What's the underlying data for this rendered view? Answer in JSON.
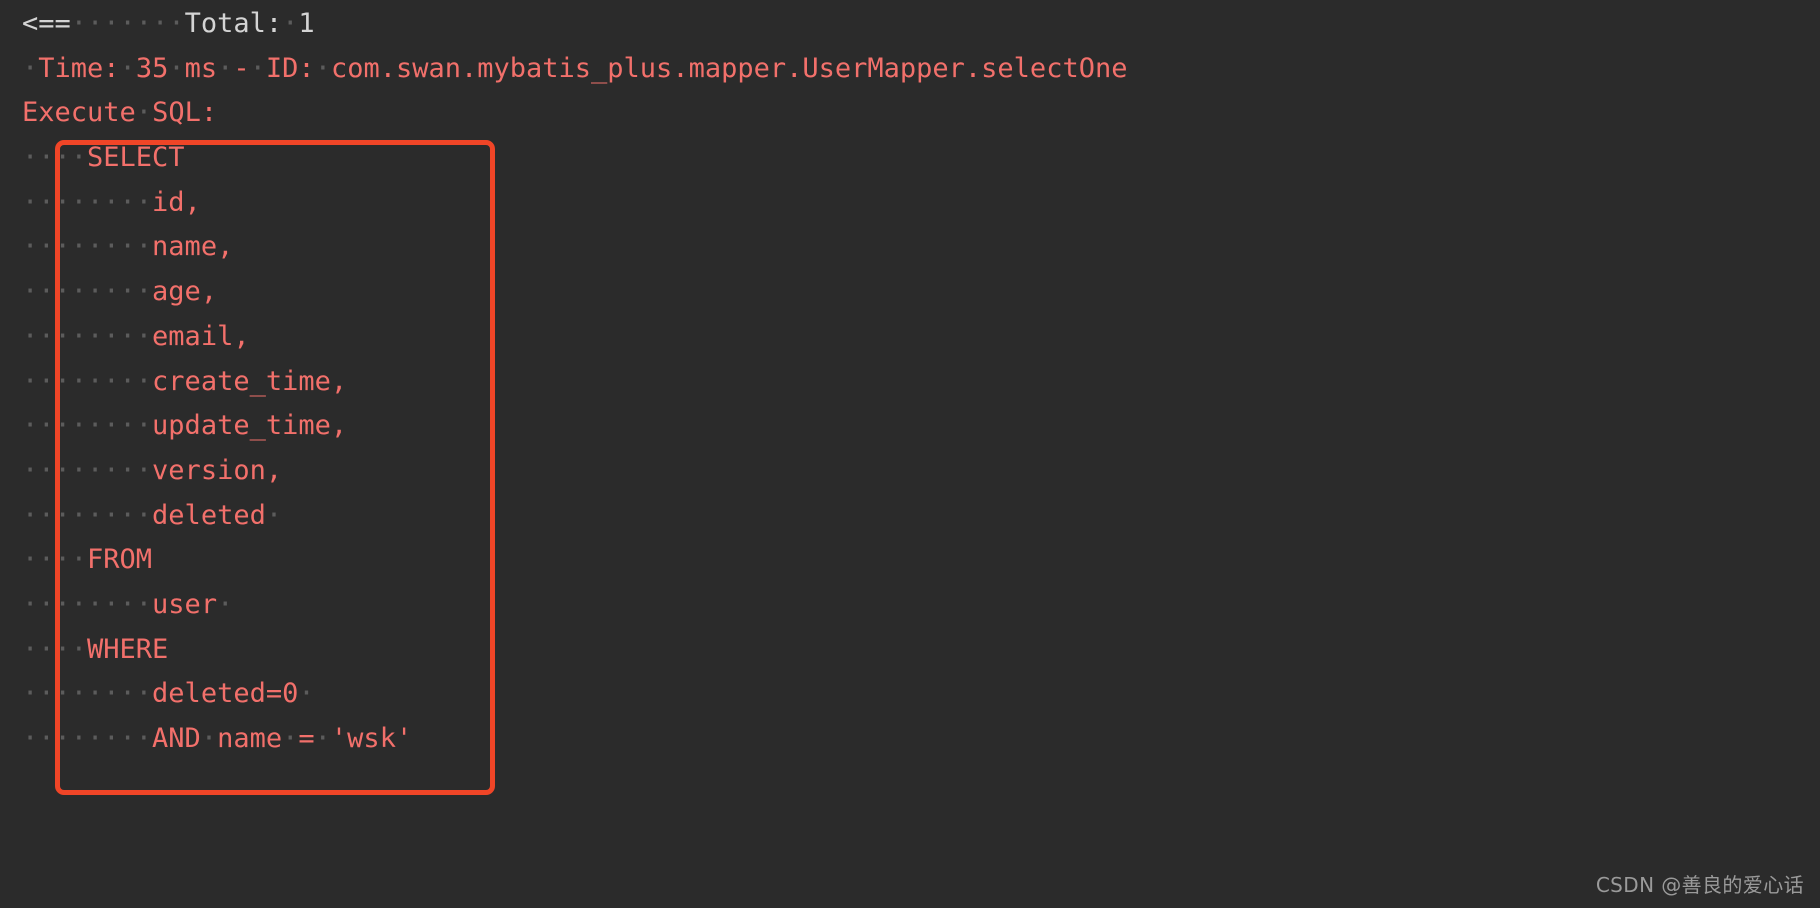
{
  "console": {
    "background_color": "#2b2b2b",
    "text_color_primary": "#d4d4d4",
    "text_color_sql": "#f2706b",
    "whitespace_dot_color": "#585858",
    "lines": [
      {
        "id": "result-total",
        "segments": [
          {
            "text": "<==",
            "style": "white"
          },
          {
            "text": "·······",
            "style": "dot"
          },
          {
            "text": "Total:",
            "style": "white"
          },
          {
            "text": "·",
            "style": "dot"
          },
          {
            "text": "1",
            "style": "white"
          }
        ]
      },
      {
        "id": "timing-and-id",
        "segments": [
          {
            "text": "·",
            "style": "dot"
          },
          {
            "text": "Time:",
            "style": "red"
          },
          {
            "text": "·",
            "style": "dot"
          },
          {
            "text": "35",
            "style": "red"
          },
          {
            "text": "·",
            "style": "dot"
          },
          {
            "text": "ms",
            "style": "red"
          },
          {
            "text": "·",
            "style": "dot"
          },
          {
            "text": "-",
            "style": "red"
          },
          {
            "text": "·",
            "style": "dot"
          },
          {
            "text": "ID:",
            "style": "red"
          },
          {
            "text": "·",
            "style": "dot"
          },
          {
            "text": "com.swan.mybatis_plus.mapper.UserMapper.selectOne",
            "style": "red"
          }
        ]
      },
      {
        "id": "execute-sql-label",
        "segments": [
          {
            "text": "Execute",
            "style": "red"
          },
          {
            "text": "·",
            "style": "dot"
          },
          {
            "text": "SQL:",
            "style": "red"
          }
        ]
      },
      {
        "id": "sql-select",
        "segments": [
          {
            "text": "····",
            "style": "dot"
          },
          {
            "text": "SELECT",
            "style": "red"
          }
        ]
      },
      {
        "id": "sql-col-id",
        "segments": [
          {
            "text": "········",
            "style": "dot"
          },
          {
            "text": "id,",
            "style": "red"
          }
        ]
      },
      {
        "id": "sql-col-name",
        "segments": [
          {
            "text": "········",
            "style": "dot"
          },
          {
            "text": "name,",
            "style": "red"
          }
        ]
      },
      {
        "id": "sql-col-age",
        "segments": [
          {
            "text": "········",
            "style": "dot"
          },
          {
            "text": "age,",
            "style": "red"
          }
        ]
      },
      {
        "id": "sql-col-email",
        "segments": [
          {
            "text": "········",
            "style": "dot"
          },
          {
            "text": "email,",
            "style": "red"
          }
        ]
      },
      {
        "id": "sql-col-create-time",
        "segments": [
          {
            "text": "········",
            "style": "dot"
          },
          {
            "text": "create_time,",
            "style": "red"
          }
        ]
      },
      {
        "id": "sql-col-update-time",
        "segments": [
          {
            "text": "········",
            "style": "dot"
          },
          {
            "text": "update_time,",
            "style": "red"
          }
        ]
      },
      {
        "id": "sql-col-version",
        "segments": [
          {
            "text": "········",
            "style": "dot"
          },
          {
            "text": "version,",
            "style": "red"
          }
        ]
      },
      {
        "id": "sql-col-deleted",
        "segments": [
          {
            "text": "········",
            "style": "dot"
          },
          {
            "text": "deleted",
            "style": "red"
          },
          {
            "text": "·",
            "style": "dot"
          }
        ]
      },
      {
        "id": "sql-from",
        "segments": [
          {
            "text": "····",
            "style": "dot"
          },
          {
            "text": "FROM",
            "style": "red"
          }
        ]
      },
      {
        "id": "sql-table-user",
        "segments": [
          {
            "text": "········",
            "style": "dot"
          },
          {
            "text": "user",
            "style": "red"
          },
          {
            "text": "·",
            "style": "dot"
          }
        ]
      },
      {
        "id": "sql-where",
        "segments": [
          {
            "text": "····",
            "style": "dot"
          },
          {
            "text": "WHERE",
            "style": "red"
          }
        ]
      },
      {
        "id": "sql-cond-deleted",
        "segments": [
          {
            "text": "········",
            "style": "dot"
          },
          {
            "text": "deleted=0",
            "style": "red"
          },
          {
            "text": "·",
            "style": "dot"
          }
        ]
      },
      {
        "id": "sql-cond-name",
        "segments": [
          {
            "text": "········",
            "style": "dot"
          },
          {
            "text": "AND",
            "style": "red"
          },
          {
            "text": "·",
            "style": "dot"
          },
          {
            "text": "name",
            "style": "red"
          },
          {
            "text": "·",
            "style": "dot"
          },
          {
            "text": "=",
            "style": "red"
          },
          {
            "text": "·",
            "style": "dot"
          },
          {
            "text": "'wsk'",
            "style": "red"
          }
        ]
      }
    ]
  },
  "annotation": {
    "shape": "rectangle",
    "color": "#f04527",
    "border_width_px": 5,
    "encloses": "executed-sql-statement"
  },
  "watermark": {
    "text": "CSDN @善良的爱心话",
    "color": "#9a9a9a"
  }
}
